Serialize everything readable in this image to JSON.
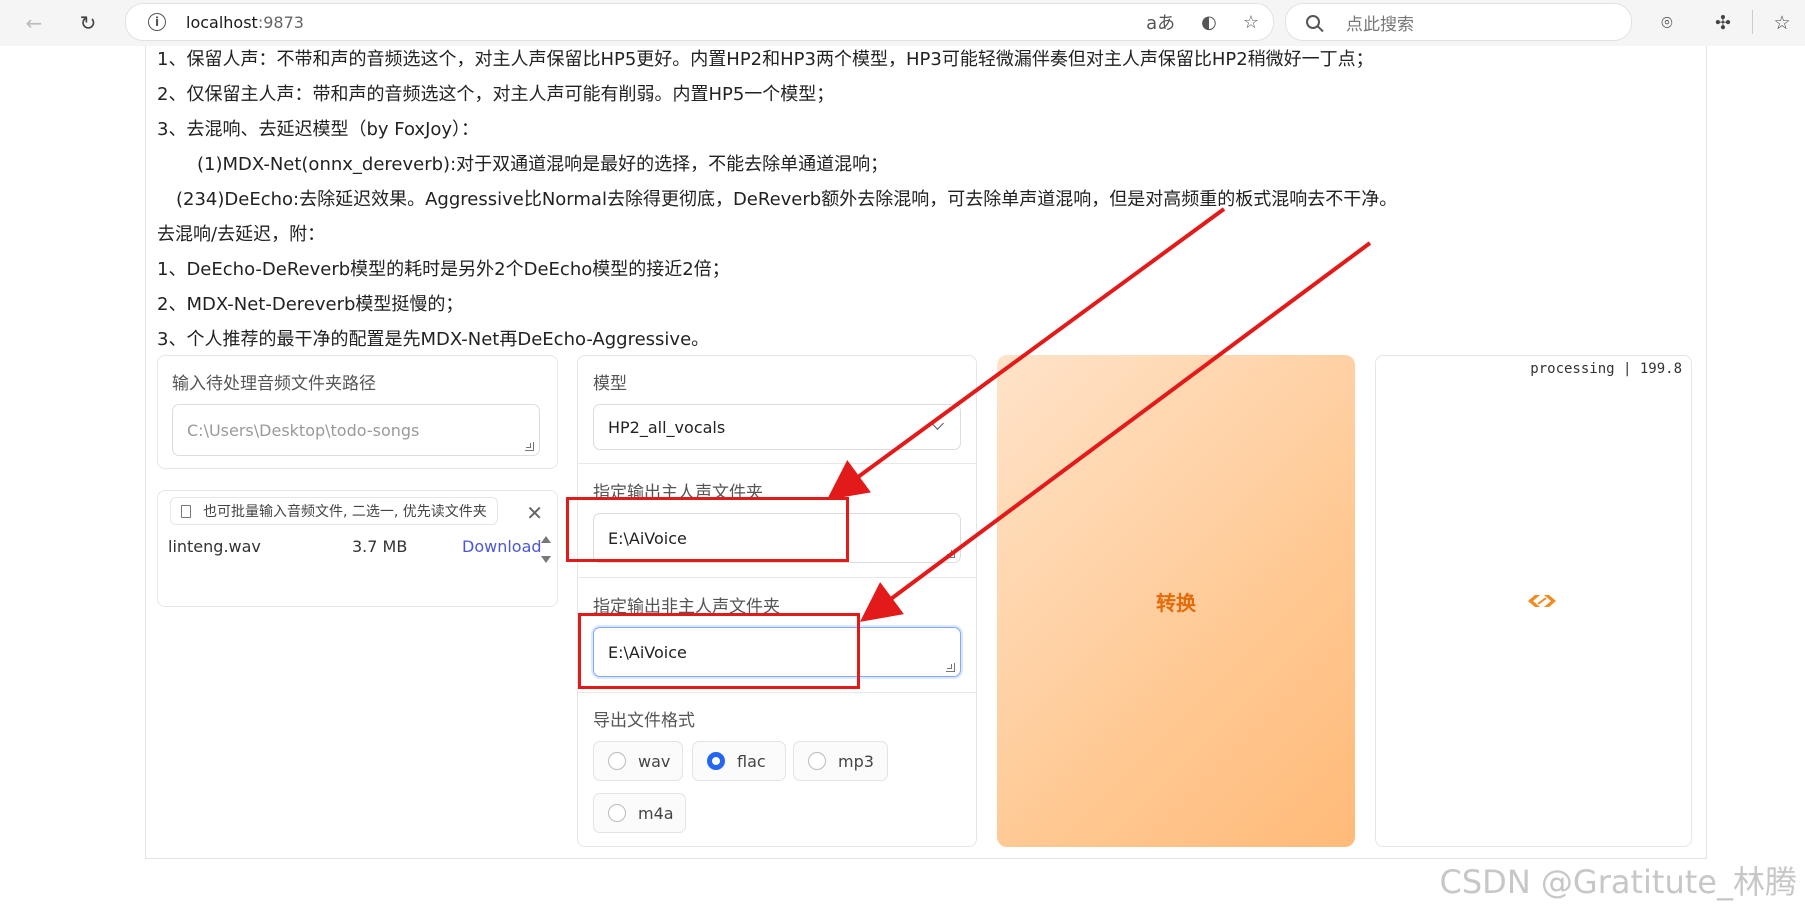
{
  "browser": {
    "url_host": "localhost",
    "url_port": ":9873",
    "search_placeholder": "点此搜索",
    "read_aloud_glyph": "aあ"
  },
  "notes": [
    "1、保留人声：不带和声的音频选这个，对主人声保留比HP5更好。内置HP2和HP3两个模型，HP3可能轻微漏伴奏但对主人声保留比HP2稍微好一丁点；",
    "2、仅保留主人声：带和声的音频选这个，对主人声可能有削弱。内置HP5一个模型；",
    "3、去混响、去延迟模型（by FoxJoy）：",
    "(1)MDX-Net(onnx_dereverb):对于双通道混响是最好的选择，不能去除单通道混响；",
    "(234)DeEcho:去除延迟效果。Aggressive比Normal去除得更彻底，DeReverb额外去除混响，可去除单声道混响，但是对高频重的板式混响去不干净。",
    "去混响/去延迟，附：",
    "1、DeEcho-DeReverb模型的耗时是另外2个DeEcho模型的接近2倍；",
    "2、MDX-Net-Dereverb模型挺慢的；",
    "3、个人推荐的最干净的配置是先MDX-Net再DeEcho-Aggressive。"
  ],
  "input_folder": {
    "label": "输入待处理音频文件夹路径",
    "placeholder": "C:\\Users\\Desktop\\todo-songs"
  },
  "file_upload": {
    "tab_label": "也可批量输入音频文件, 二选一, 优先读文件夹",
    "file_name": "linteng.wav",
    "file_size": "3.7 MB",
    "download_label": "Download"
  },
  "model": {
    "label": "模型",
    "selected": "HP2_all_vocals"
  },
  "vocal_output": {
    "label": "指定输出主人声文件夹",
    "value": "E:\\AiVoice"
  },
  "instrumental_output": {
    "label": "指定输出非主人声文件夹",
    "value": "E:\\AiVoice"
  },
  "format": {
    "label": "导出文件格式",
    "options": [
      "wav",
      "flac",
      "mp3",
      "m4a"
    ],
    "selected": "flac"
  },
  "convert_button": "转换",
  "status": "processing | 199.8",
  "watermark": "CSDN @Gratitute_林腾",
  "colors": {
    "accent_orange": "#e46b0a",
    "radio_blue": "#2466f2",
    "annotation_red": "#e31a1a",
    "link_blue": "#4b57d6"
  }
}
